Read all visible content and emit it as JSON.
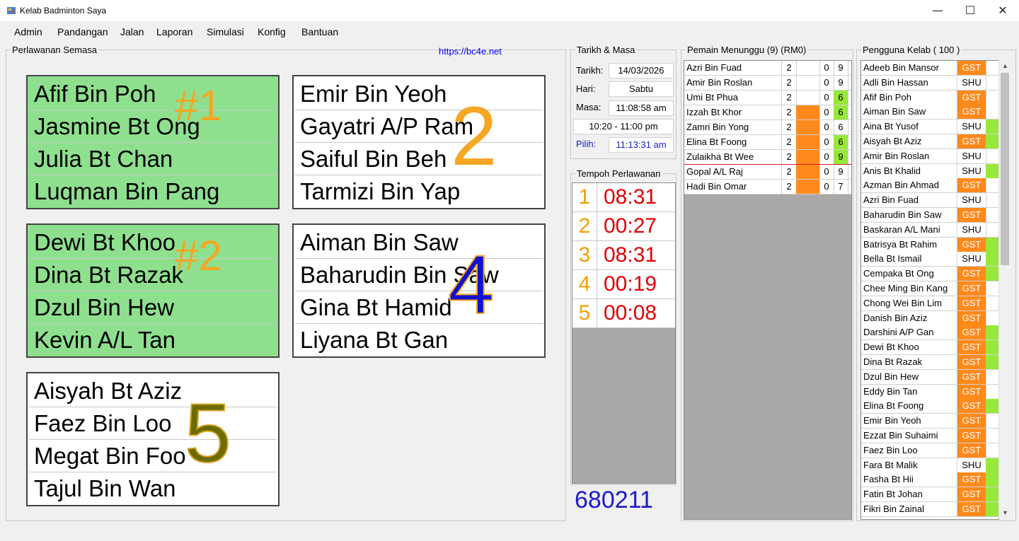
{
  "window": {
    "title": "Kelab Badminton Saya",
    "minimize": "—",
    "maximize": "☐",
    "close": "✕"
  },
  "menu": [
    "Admin",
    "Pandangan",
    "Jalan",
    "Laporan",
    "Simulasi",
    "Konfig",
    "Bantuan"
  ],
  "current_matches": {
    "legend": "Perlawanan Semasa",
    "link": "https://bc4e.net",
    "courts": [
      {
        "number": "#1",
        "active": true,
        "number_color": "#f5a623",
        "players": [
          "Afif Bin Poh",
          "Jasmine Bt Ong",
          "Julia Bt Chan",
          "Luqman Bin Pang"
        ]
      },
      {
        "number": "2",
        "active": false,
        "number_color": "#f5a623",
        "players": [
          "Emir Bin Yeoh",
          "Gayatri A/P Ram",
          "Saiful Bin Beh",
          "Tarmizi Bin Yap"
        ]
      },
      {
        "number": "#2",
        "active": true,
        "number_color": "#f5a623",
        "players": [
          "Dewi Bt Khoo",
          "Dina Bt Razak",
          "Dzul Bin Hew",
          "Kevin A/L Tan"
        ]
      },
      {
        "number": "4",
        "active": false,
        "number_color": "#1010d0",
        "players": [
          "Aiman Bin Saw",
          "Baharudin Bin Saw",
          "Gina Bt Hamid",
          "Liyana Bt Gan"
        ]
      },
      {
        "number": "5",
        "active": false,
        "number_color": "#6b6b00",
        "players": [
          "Aisyah Bt Aziz",
          "Faez Bin Loo",
          "Megat Bin Foo",
          "Tajul Bin Wan"
        ]
      }
    ]
  },
  "datetime": {
    "legend": "Tarikh & Masa",
    "date_label": "Tarikh:",
    "date": "14/03/2026",
    "day_label": "Hari:",
    "day": "Sabtu",
    "time_label": "Masa:",
    "time": "11:08:58 am",
    "session": "10:20 - 11:00 pm",
    "pick_label": "Pilih:",
    "pick": "11:13:31 am"
  },
  "durations": {
    "legend": "Tempoh Perlawanan",
    "items": [
      {
        "n": "1",
        "t": "08:31"
      },
      {
        "n": "2",
        "t": "00:27"
      },
      {
        "n": "3",
        "t": "08:31"
      },
      {
        "n": "4",
        "t": "00:19"
      },
      {
        "n": "5",
        "t": "00:08"
      }
    ]
  },
  "code": "680211",
  "waiting": {
    "legend": "Pemain Menunggu (9) (RM0)",
    "rows": [
      {
        "name": "Azri Bin Fuad",
        "a": "2",
        "orange": false,
        "b": "0",
        "c": "9",
        "c_lime": false
      },
      {
        "name": "Amir Bin Roslan",
        "a": "2",
        "orange": false,
        "b": "0",
        "c": "9",
        "c_lime": false
      },
      {
        "name": "Umi Bt Phua",
        "a": "2",
        "orange": false,
        "b": "0",
        "c": "6",
        "c_lime": true
      },
      {
        "name": "Izzah Bt Khor",
        "a": "2",
        "orange": true,
        "b": "0",
        "c": "6",
        "c_lime": true
      },
      {
        "name": "Zamri Bin Yong",
        "a": "2",
        "orange": true,
        "b": "0",
        "c": "6",
        "c_lime": false
      },
      {
        "name": "Elina Bt Foong",
        "a": "2",
        "orange": true,
        "b": "0",
        "c": "6",
        "c_lime": true
      },
      {
        "name": "Zulaikha Bt Wee",
        "a": "2",
        "orange": true,
        "b": "0",
        "c": "9",
        "c_lime": true
      },
      {
        "name": "Gopal A/L Raj",
        "a": "2",
        "orange": true,
        "b": "0",
        "c": "9",
        "c_lime": false
      },
      {
        "name": "Hadi Bin Omar",
        "a": "2",
        "orange": true,
        "b": "0",
        "c": "7",
        "c_lime": false
      }
    ]
  },
  "members": {
    "legend": "Pengguna Kelab ( 100 )",
    "rows": [
      {
        "name": "Adeeb Bin Mansor",
        "type": "GST",
        "lime": false
      },
      {
        "name": "Adli Bin Hassan",
        "type": "SHU",
        "lime": false
      },
      {
        "name": "Afif Bin Poh",
        "type": "GST",
        "lime": false
      },
      {
        "name": "Aiman Bin Saw",
        "type": "GST",
        "lime": false
      },
      {
        "name": "Aina Bt Yusof",
        "type": "SHU",
        "lime": true
      },
      {
        "name": "Aisyah Bt Aziz",
        "type": "GST",
        "lime": true
      },
      {
        "name": "Amir Bin Roslan",
        "type": "SHU",
        "lime": false
      },
      {
        "name": "Anis Bt Khalid",
        "type": "SHU",
        "lime": true
      },
      {
        "name": "Azman Bin Ahmad",
        "type": "GST",
        "lime": false
      },
      {
        "name": "Azri Bin Fuad",
        "type": "SHU",
        "lime": false
      },
      {
        "name": "Baharudin Bin Saw",
        "type": "GST",
        "lime": false
      },
      {
        "name": "Baskaran A/L Mani",
        "type": "SHU",
        "lime": false
      },
      {
        "name": "Batrisya Bt Rahim",
        "type": "GST",
        "lime": true
      },
      {
        "name": "Bella Bt Ismail",
        "type": "SHU",
        "lime": true
      },
      {
        "name": "Cempaka Bt Ong",
        "type": "GST",
        "lime": true
      },
      {
        "name": "Chee Ming Bin Kang",
        "type": "GST",
        "lime": false
      },
      {
        "name": "Chong Wei Bin Lim",
        "type": "GST",
        "lime": false
      },
      {
        "name": "Danish Bin Aziz",
        "type": "GST",
        "lime": false
      },
      {
        "name": "Darshini A/P Gan",
        "type": "GST",
        "lime": true
      },
      {
        "name": "Dewi Bt Khoo",
        "type": "GST",
        "lime": true
      },
      {
        "name": "Dina Bt Razak",
        "type": "GST",
        "lime": true
      },
      {
        "name": "Dzul Bin Hew",
        "type": "GST",
        "lime": false
      },
      {
        "name": "Eddy Bin Tan",
        "type": "GST",
        "lime": false
      },
      {
        "name": "Elina Bt Foong",
        "type": "GST",
        "lime": true
      },
      {
        "name": "Emir Bin Yeoh",
        "type": "GST",
        "lime": false
      },
      {
        "name": "Ezzat Bin Suhaimi",
        "type": "GST",
        "lime": false
      },
      {
        "name": "Faez Bin Loo",
        "type": "GST",
        "lime": false
      },
      {
        "name": "Fara Bt Malik",
        "type": "SHU",
        "lime": true
      },
      {
        "name": "Fasha Bt Hii",
        "type": "GST",
        "lime": true
      },
      {
        "name": "Fatin Bt Johan",
        "type": "GST",
        "lime": true
      },
      {
        "name": "Fikri Bin Zainal",
        "type": "GST",
        "lime": true
      }
    ]
  }
}
